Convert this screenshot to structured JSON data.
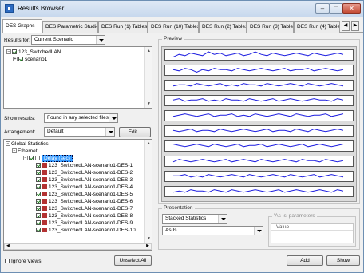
{
  "window": {
    "title": "Results Browser",
    "min": "–",
    "max": "□",
    "close": "✕"
  },
  "tabs": [
    "DES Graphs",
    "DES Parametric Studies",
    "DES Run (1) Tables",
    "DES Run (10) Tables",
    "DES Run (2) Tables",
    "DES Run (3) Tables",
    "DES Run (4) Tables"
  ],
  "tab_nav": {
    "prev": "◀",
    "next": "▶"
  },
  "results_for": {
    "label": "Results for:",
    "value": "Current Scenario"
  },
  "scenario_tree": [
    {
      "label": "123_SwitchedLAN"
    },
    {
      "label": "scenario1"
    }
  ],
  "show_results": {
    "label": "Show results:",
    "value": "Found in any selected files"
  },
  "arrangement": {
    "label": "Arrangement:",
    "value": "Default",
    "edit": "Edit..."
  },
  "stats_tree": {
    "global": "Global Statistics",
    "ethernet": "Ethernet",
    "delay": "Delay (sec)",
    "items": [
      "123_SwitchedLAN-scenario1-DES-1",
      "123_SwitchedLAN-scenario1-DES-2",
      "123_SwitchedLAN-scenario1-DES-3",
      "123_SwitchedLAN-scenario1-DES-4",
      "123_SwitchedLAN-scenario1-DES-5",
      "123_SwitchedLAN-scenario1-DES-6",
      "123_SwitchedLAN-scenario1-DES-7",
      "123_SwitchedLAN-scenario1-DES-8",
      "123_SwitchedLAN-scenario1-DES-9",
      "123_SwitchedLAN-scenario1-DES-10"
    ]
  },
  "ignore_views": "Ignore Views",
  "unselect_all": "Unselect All",
  "preview": {
    "title": "Preview",
    "line_color": "#1f1fe0",
    "charts": [
      [
        3,
        5,
        4,
        6,
        5,
        4,
        7,
        5,
        6,
        4,
        5,
        6,
        4,
        5,
        7,
        5,
        4,
        6,
        5,
        4,
        5,
        6,
        5,
        4,
        6,
        5,
        4,
        5,
        6,
        5
      ],
      [
        5,
        4,
        6,
        5,
        3,
        5,
        4,
        6,
        5,
        5,
        4,
        6,
        5,
        4,
        5,
        6,
        5,
        4,
        5,
        6,
        4,
        5,
        5,
        6,
        4,
        5,
        6,
        5,
        4,
        5
      ],
      [
        4,
        5,
        5,
        4,
        6,
        5,
        4,
        5,
        6,
        4,
        5,
        4,
        6,
        5,
        5,
        4,
        6,
        5,
        4,
        5,
        6,
        5,
        4,
        6,
        5,
        4,
        5,
        6,
        5,
        4
      ],
      [
        5,
        6,
        4,
        5,
        5,
        6,
        4,
        5,
        4,
        6,
        5,
        5,
        4,
        6,
        5,
        4,
        5,
        6,
        4,
        5,
        6,
        5,
        4,
        5,
        6,
        5,
        5,
        4,
        6,
        5
      ],
      [
        4,
        5,
        6,
        5,
        4,
        5,
        6,
        4,
        5,
        5,
        6,
        4,
        5,
        4,
        6,
        5,
        4,
        5,
        6,
        5,
        4,
        6,
        5,
        4,
        5,
        5,
        6,
        4,
        5,
        6
      ],
      [
        5,
        4,
        5,
        6,
        4,
        5,
        5,
        4,
        6,
        5,
        4,
        5,
        6,
        5,
        4,
        5,
        6,
        4,
        5,
        5,
        4,
        6,
        5,
        4,
        6,
        5,
        4,
        5,
        6,
        5
      ],
      [
        6,
        5,
        4,
        5,
        6,
        5,
        4,
        6,
        5,
        4,
        5,
        6,
        4,
        5,
        5,
        6,
        4,
        5,
        6,
        5,
        4,
        5,
        6,
        4,
        5,
        6,
        5,
        4,
        5,
        6
      ],
      [
        4,
        6,
        5,
        4,
        5,
        6,
        5,
        4,
        5,
        6,
        4,
        5,
        6,
        5,
        4,
        6,
        5,
        4,
        5,
        6,
        5,
        4,
        6,
        5,
        5,
        4,
        6,
        5,
        4,
        5
      ],
      [
        5,
        5,
        6,
        4,
        5,
        4,
        6,
        5,
        4,
        5,
        6,
        5,
        4,
        6,
        5,
        4,
        5,
        6,
        5,
        4,
        6,
        5,
        4,
        5,
        6,
        4,
        5,
        6,
        5,
        4
      ],
      [
        4,
        5,
        4,
        6,
        5,
        5,
        4,
        6,
        5,
        4,
        6,
        5,
        4,
        5,
        6,
        5,
        4,
        5,
        6,
        4,
        5,
        6,
        5,
        4,
        5,
        6,
        5,
        4,
        6,
        5
      ]
    ]
  },
  "presentation": {
    "title": "Presentation",
    "mode": "Stacked Statistics",
    "filter": "As Is",
    "params_title": "'As Is' parameters",
    "value_header": "Value"
  },
  "add": "Add",
  "show": "Show"
}
